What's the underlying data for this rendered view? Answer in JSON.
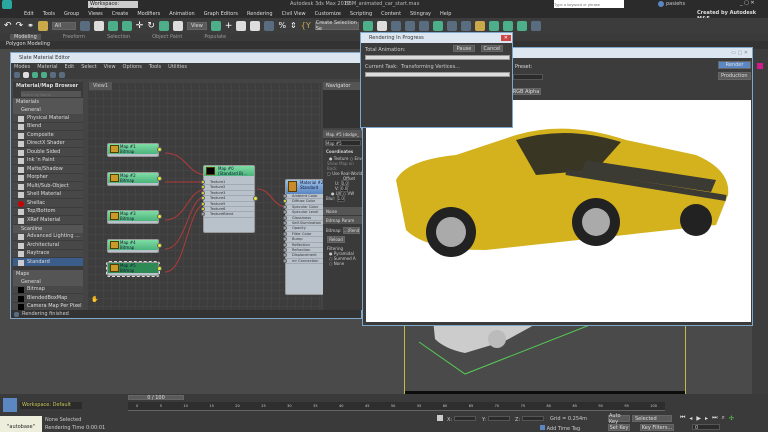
{
  "app": {
    "workspace": "Workspace: Default",
    "title": "Autodesk 3ds Max 2017",
    "file": "BBM_animated_car_start.max",
    "search_placeholder": "Type a keyword or phrase",
    "user": "pasiehs",
    "credit": "Created by Autodesk M&E"
  },
  "menu": [
    "Edit",
    "Tools",
    "Group",
    "Views",
    "Create",
    "Modifiers",
    "Animation",
    "Graph Editors",
    "Rendering",
    "Civil View",
    "Customize",
    "Scripting",
    "Content",
    "Stingray",
    "Help"
  ],
  "toolbar": {
    "filter": "All",
    "ref": "View",
    "selection_set": "Create Selection Se"
  },
  "ribbon": {
    "tabs": [
      "Modeling",
      "Freeform",
      "Selection",
      "Object Paint",
      "Populate"
    ],
    "panel": "Polygon Modeling"
  },
  "slate": {
    "title": "Slate Material Editor",
    "menu": [
      "Modes",
      "Material",
      "Edit",
      "Select",
      "View",
      "Options",
      "Tools",
      "Utilities"
    ],
    "browser_title": "Material/Map Browser",
    "search_placeholder": "Search by Name ...",
    "materials_label": "Materials",
    "general_label": "General",
    "scanline_label": "Scanline",
    "maps_label": "Maps",
    "maps_general_label": "General",
    "general_items": [
      "Physical Material",
      "Blend",
      "Composite",
      "DirectX Shader",
      "Double Sided",
      "Ink 'n Paint",
      "Matte/Shadow",
      "Morpher",
      "Multi/Sub-Object",
      "Shell Material",
      "Shellac",
      "Top/Bottom",
      "XRef Material"
    ],
    "scanline_items": [
      "Advanced Lighting ...",
      "Architectural",
      "Raytrace",
      "Standard"
    ],
    "map_items": [
      "Bitmap",
      "BlendedBoxMap",
      "Camera Map Per Pixel"
    ],
    "view_tab": "View1",
    "navigator": "Navigator",
    "maps": [
      {
        "name": "Map #1",
        "type": "Bitmap"
      },
      {
        "name": "Map #2",
        "type": "Bitmap"
      },
      {
        "name": "Map #3",
        "type": "Bitmap"
      },
      {
        "name": "Map #4",
        "type": "Bitmap"
      },
      {
        "name": "Map #5",
        "type": "Bitmap"
      }
    ],
    "blend_node": {
      "name": "Map #0",
      "type": "(Standard B)...",
      "slots": [
        "Texture1",
        "Texture2",
        "Texture3",
        "Texture4",
        "Texture5",
        "Texture6",
        "TextureBlend"
      ]
    },
    "material_node": {
      "name": "Material #2",
      "type": "Standard",
      "slots": [
        "Ambient Color",
        "Diffuse Color",
        "Specular Color",
        "Specular Level",
        "Glossiness",
        "Self-Illumination",
        "Opacity",
        "Filter Color",
        "Bump",
        "Reflection",
        "Refraction",
        "Displacement",
        "mr Connection"
      ]
    },
    "params": {
      "header": "Map #5 (dodge_",
      "name": "Map #5",
      "coordinates": "Coordinates",
      "texture": "Texture",
      "env": "Env",
      "show_map": "Show Map on Back",
      "use_real": "Use Real-World",
      "offset": "Offset",
      "u": "U:",
      "u_val": "0.0",
      "v": "V:",
      "v_val": "0.0",
      "uv": "UV",
      "vw": "VW",
      "blur": "Blur:",
      "blur_val": "1.0",
      "noise": "Noise",
      "bitmap_params": "Bitmap Param",
      "bitmap_label": "Bitmap:",
      "bitmap_val": "...\\Rend",
      "reload": "Reload",
      "filtering": "Filtering",
      "pyramidal": "Pyramidal",
      "summed": "Summed A",
      "none": "None"
    },
    "status": "Rendering finished"
  },
  "progress": {
    "title": "Rendering In Progress",
    "total": "Total Animation:",
    "pause": "Pause",
    "cancel": "Cancel",
    "task_label": "Current Task:",
    "task": "Transforming Vertices...",
    "total_pct": 0,
    "task_pct": 0
  },
  "render_frame": {
    "preset": "Preset:",
    "render": "Render",
    "production": "Production",
    "channel": "RGB Alpha"
  },
  "bottom": {
    "workspace": "Workspace: Default",
    "frame": "0 / 100",
    "ticks": [
      "0",
      "5",
      "10",
      "15",
      "20",
      "25",
      "30",
      "35",
      "40",
      "45",
      "50",
      "55",
      "60",
      "65",
      "70",
      "75",
      "80",
      "85",
      "90",
      "95",
      "100"
    ],
    "maxscript": "\"autobase\"",
    "selection": "None Selected",
    "render_time": "Rendering Time  0:00:01",
    "x": "X:",
    "y": "Y:",
    "z": "Z:",
    "grid": "Grid = 0.254m",
    "add_time_tag": "Add Time Tag",
    "auto_key": "Auto Key",
    "selected": "Selected",
    "set_key": "Set Key",
    "key_filters": "Key Filters...",
    "current_frame": "0"
  },
  "colors": {
    "accent": "#5b87c2",
    "node_green": "#5cc48a",
    "car": "#d4b21e",
    "wire": "#b03a3a"
  }
}
